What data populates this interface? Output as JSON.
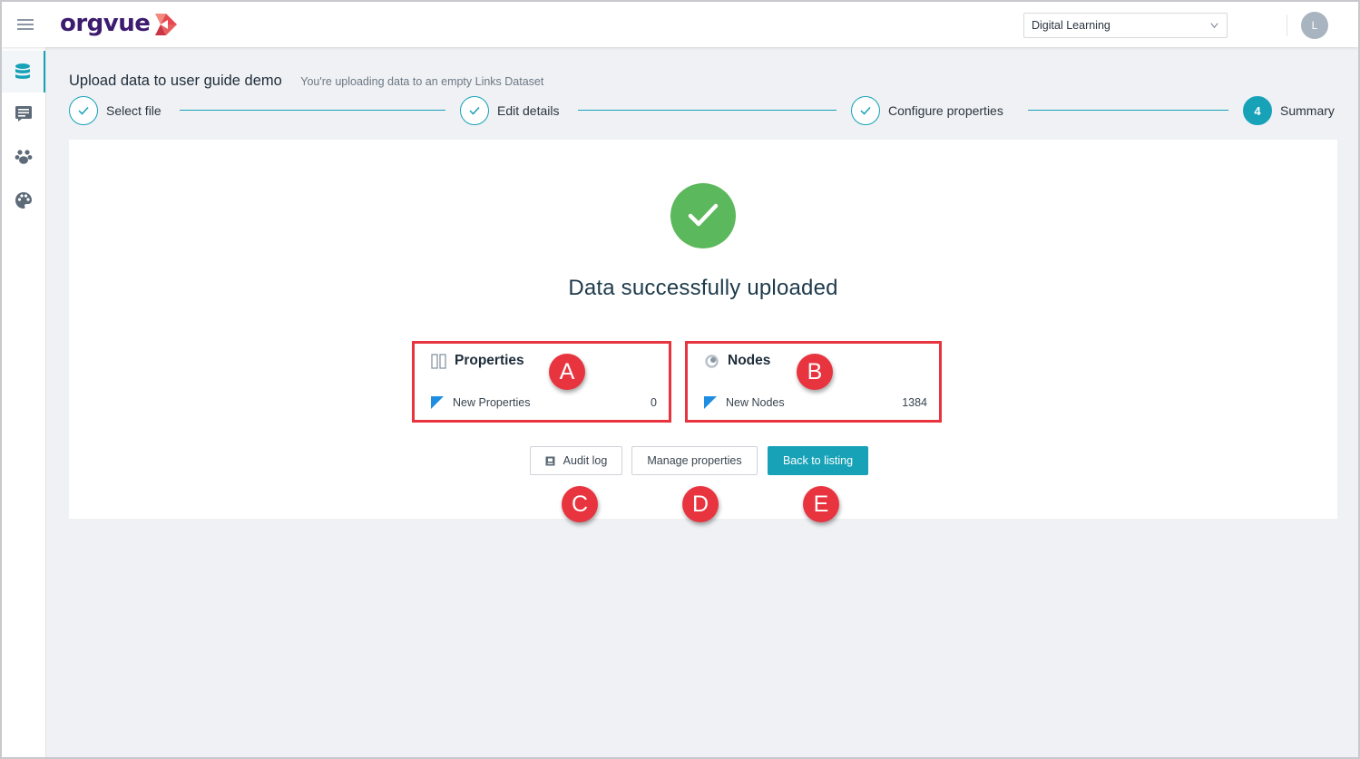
{
  "app": {
    "logo_text": "orgvue"
  },
  "header": {
    "workspace_select": "Digital Learning",
    "user_initial": "L"
  },
  "sidebar": {
    "items": [
      {
        "icon": "database-icon"
      },
      {
        "icon": "list-icon"
      },
      {
        "icon": "paw-icon"
      },
      {
        "icon": "palette-icon"
      }
    ]
  },
  "page": {
    "title": "Upload data to user guide demo",
    "subtitle": "You're uploading data to an empty Links Dataset"
  },
  "steps": [
    {
      "label": "Select file",
      "state": "done"
    },
    {
      "label": "Edit details",
      "state": "done"
    },
    {
      "label": "Configure properties",
      "state": "done"
    },
    {
      "number": "4",
      "label": "Summary",
      "state": "current"
    }
  ],
  "summary": {
    "message": "Data successfully uploaded",
    "properties": {
      "title": "Properties",
      "row_label": "New Properties",
      "row_value": "0"
    },
    "nodes": {
      "title": "Nodes",
      "row_label": "New Nodes",
      "row_value": "1384"
    }
  },
  "actions": {
    "audit_log": "Audit log",
    "manage_properties": "Manage properties",
    "back_to_listing": "Back to listing"
  },
  "callouts": {
    "a": "A",
    "b": "B",
    "c": "C",
    "d": "D",
    "e": "E"
  },
  "colors": {
    "accent": "#17a2b8",
    "success": "#5cb85c",
    "callout": "#e8343f",
    "brand": "#3d1b6e",
    "brand_mark": "#e8474f"
  }
}
